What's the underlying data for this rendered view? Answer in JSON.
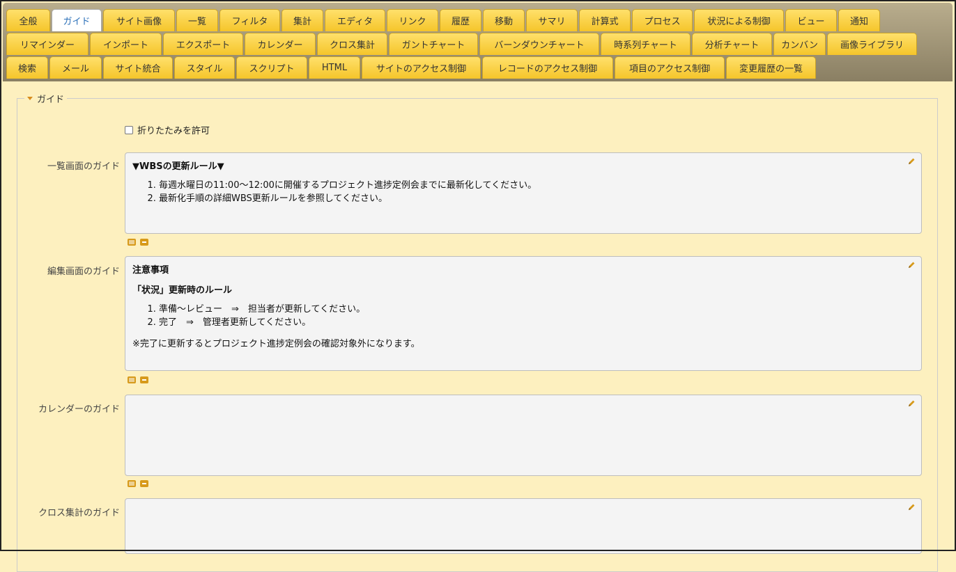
{
  "tabs": {
    "row1": [
      "全般",
      "ガイド",
      "サイト画像",
      "一覧",
      "フィルタ",
      "集計",
      "エディタ",
      "リンク",
      "履歴",
      "移動",
      "サマリ",
      "計算式",
      "プロセス",
      "状況による制御",
      "ビュー",
      "通知"
    ],
    "row2": [
      "リマインダー",
      "インポート",
      "エクスポート",
      "カレンダー",
      "クロス集計",
      "ガントチャート",
      "バーンダウンチャート",
      "時系列チャート",
      "分析チャート",
      "カンバン",
      "画像ライブラリ"
    ],
    "row3": [
      "検索",
      "メール",
      "サイト統合",
      "スタイル",
      "スクリプト",
      "HTML",
      "サイトのアクセス制御",
      "レコードのアクセス制御",
      "項目のアクセス制御",
      "変更履歴の一覧"
    ],
    "active": "ガイド"
  },
  "section": {
    "legend": "ガイド",
    "allow_collapse_label": "折りたたみを許可"
  },
  "fields": {
    "index_label": "一覧画面のガイド",
    "index_heading": "▼WBSの更新ルール▼",
    "index_items": [
      "毎週水曜日の11:00～12:00に開催するプロジェクト進捗定例会までに最新化してください。",
      "最新化手順の詳細WBS更新ルールを参照してください。"
    ],
    "edit_label": "編集画面のガイド",
    "edit_heading1": "注意事項",
    "edit_heading2": "「状況」更新時のルール",
    "edit_items": [
      "準備～レビュー　⇒　担当者が更新してください。",
      "完了　⇒　管理者更新してください。"
    ],
    "edit_note": "※完了に更新するとプロジェクト進捗定例会の確認対象外になります。",
    "calendar_label": "カレンダーのガイド",
    "crosstab_label": "クロス集計のガイド"
  },
  "colors": {
    "tab": "#f5c52a",
    "page_bg": "#fdf0bf",
    "active_tab_text": "#2a6fb8",
    "icon": "#d79a1b"
  }
}
